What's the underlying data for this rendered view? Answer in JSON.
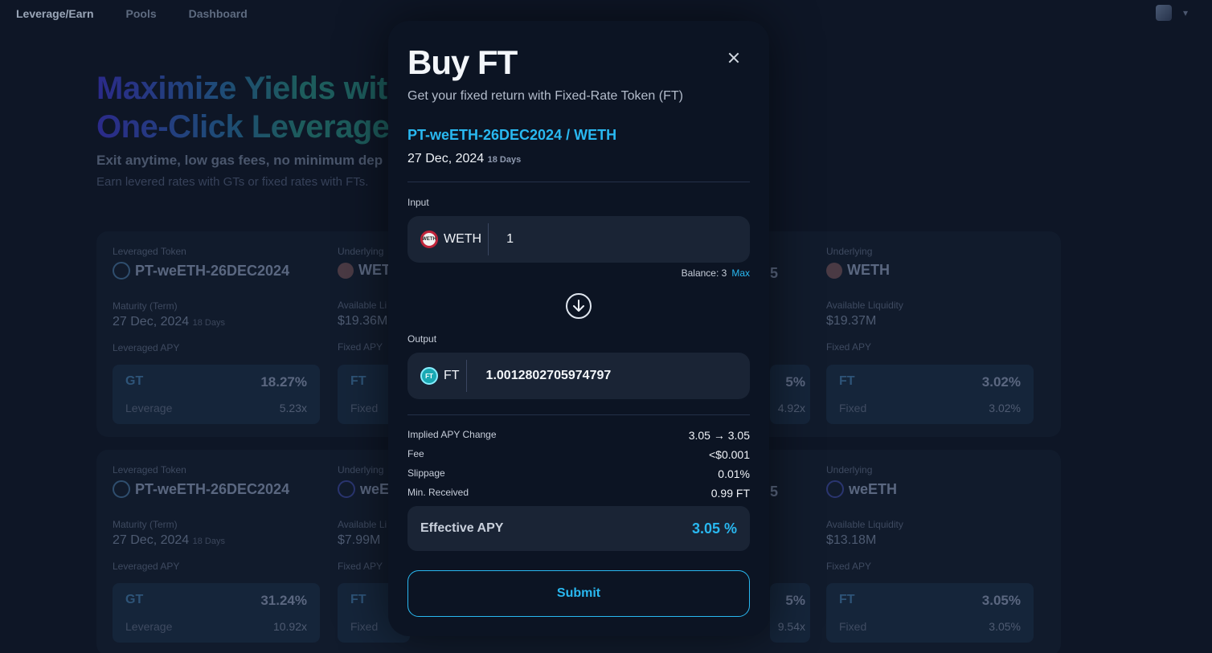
{
  "nav": {
    "items": [
      "Leverage/Earn",
      "Pools",
      "Dashboard"
    ]
  },
  "hero": {
    "title_line1": "Maximize Yields wit",
    "title_line2": "One-Click Leverage",
    "subtitle": "Exit anytime, low gas fees, no minimum dep",
    "description": "Earn levered rates with GTs or fixed rates with FTs."
  },
  "cards": [
    {
      "leveraged_label": "Leveraged Token",
      "leveraged_token": "PT-weETH-26DEC2024",
      "maturity_label": "Maturity (Term)",
      "maturity_date": "27 Dec, 2024",
      "maturity_days": "18 Days",
      "leveraged_apy_label": "Leveraged APY",
      "gt_label": "GT",
      "gt_pct": "18.27%",
      "leverage_label": "Leverage",
      "leverage_val": "5.23x",
      "underlying_label": "Underlying",
      "underlying": "WET",
      "liquidity_label": "Available Li",
      "liquidity": "$19.36M",
      "fixed_apy_label": "Fixed APY",
      "ft_label": "FT",
      "fixed_label": "Fixed",
      "mid_pct": "5%",
      "mid_lev": "4.92x",
      "mid_5": "5",
      "right_underlying_label": "Underlying",
      "right_underlying": "WETH",
      "right_liquidity_label": "Available Liquidity",
      "right_liquidity": "$19.37M",
      "right_fixed_apy_label": "Fixed APY",
      "right_ft_pct": "3.02%",
      "right_fixed_val": "3.02%"
    },
    {
      "leveraged_label": "Leveraged Token",
      "leveraged_token": "PT-weETH-26DEC2024",
      "maturity_label": "Maturity (Term)",
      "maturity_date": "27 Dec, 2024",
      "maturity_days": "18 Days",
      "leveraged_apy_label": "Leveraged APY",
      "gt_label": "GT",
      "gt_pct": "31.24%",
      "leverage_label": "Leverage",
      "leverage_val": "10.92x",
      "underlying_label": "Underlying",
      "underlying": "weE",
      "liquidity_label": "Available Li",
      "liquidity": "$7.99M",
      "fixed_apy_label": "Fixed APY",
      "ft_label": "FT",
      "fixed_label": "Fixed",
      "mid_pct": "5%",
      "mid_lev": "9.54x",
      "mid_5": "5",
      "right_underlying_label": "Underlying",
      "right_underlying": "weETH",
      "right_liquidity_label": "Available Liquidity",
      "right_liquidity": "$13.18M",
      "right_fixed_apy_label": "Fixed APY",
      "right_ft_pct": "3.05%",
      "right_fixed_val": "3.05%"
    }
  ],
  "modal": {
    "title": "Buy FT",
    "subtitle": "Get your fixed return with Fixed-Rate Token (FT)",
    "pair": "PT-weETH-26DEC2024 / WETH",
    "maturity_date": "27 Dec, 2024",
    "maturity_days": "18 Days",
    "input_label": "Input",
    "input_token": "WETH",
    "input_token_icon_text": "WETH",
    "input_value": "1",
    "balance_label": "Balance: 3",
    "max_label": "Max",
    "output_label": "Output",
    "output_token": "FT",
    "output_token_icon_text": "FT",
    "output_value": "1.0012802705974797",
    "info": [
      {
        "k": "Implied APY Change",
        "v": "3.05 → 3.05"
      },
      {
        "k": "Fee",
        "v": "<$0.001"
      },
      {
        "k": "Slippage",
        "v": "0.01%"
      },
      {
        "k": "Min. Received",
        "v": "0.99 FT"
      }
    ],
    "effective_apy_label": "Effective APY",
    "effective_apy_value": "3.05 %",
    "submit_label": "Submit"
  },
  "colors": {
    "accent": "#29b8f0",
    "background": "#0b1220",
    "modal": "#0c1423",
    "field": "#1a2435"
  },
  "icons": {
    "close": "close-icon",
    "swap": "arrow-down-circle-icon",
    "weth": "weth-token-icon",
    "ft": "ft-token-icon"
  }
}
